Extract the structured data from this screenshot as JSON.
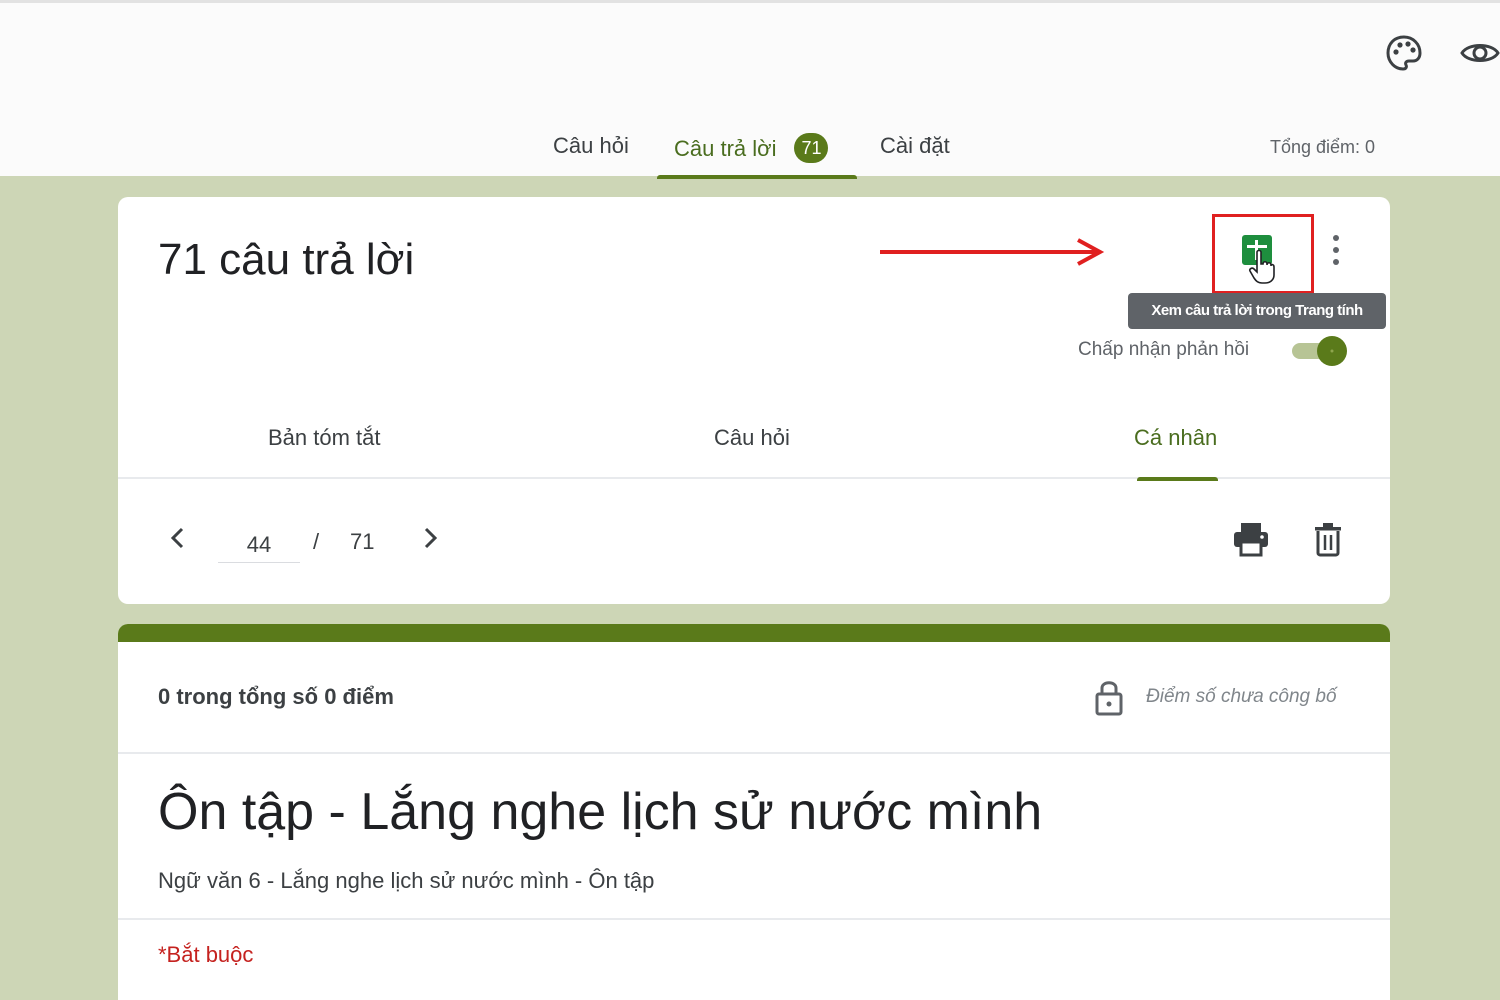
{
  "topbar": {
    "icons": [
      "palette-icon",
      "eye-icon"
    ]
  },
  "tabs": {
    "questions": "Câu hỏi",
    "responses": "Câu trả lời",
    "responses_badge": "71",
    "settings": "Cài đặt",
    "total_points": "Tổng điểm: 0"
  },
  "responses_card": {
    "title": "71 câu trả lời",
    "sheets_tooltip": "Xem câu trả lời trong Trang tính",
    "accept_label": "Chấp nhận phản hồi",
    "accepting": true,
    "subtabs": {
      "summary": "Bản tóm tắt",
      "question": "Câu hỏi",
      "individual": "Cá nhân"
    },
    "pager": {
      "current": "44",
      "separator": "/",
      "total": "71"
    }
  },
  "form_card": {
    "score": "0 trong tổng số 0 điểm",
    "score_status": "Điểm số chưa công bố",
    "title": "Ôn tập - Lắng nghe lịch sử nước mình",
    "description": "Ngữ văn 6 - Lắng nghe lịch sử nước mình - Ôn tập",
    "required_note": "*Bắt buộc"
  },
  "colors": {
    "accent": "#5a7a1a",
    "background": "#cdd6b6",
    "highlight_box": "#e02020",
    "sheets_green": "#1e8e3e"
  }
}
